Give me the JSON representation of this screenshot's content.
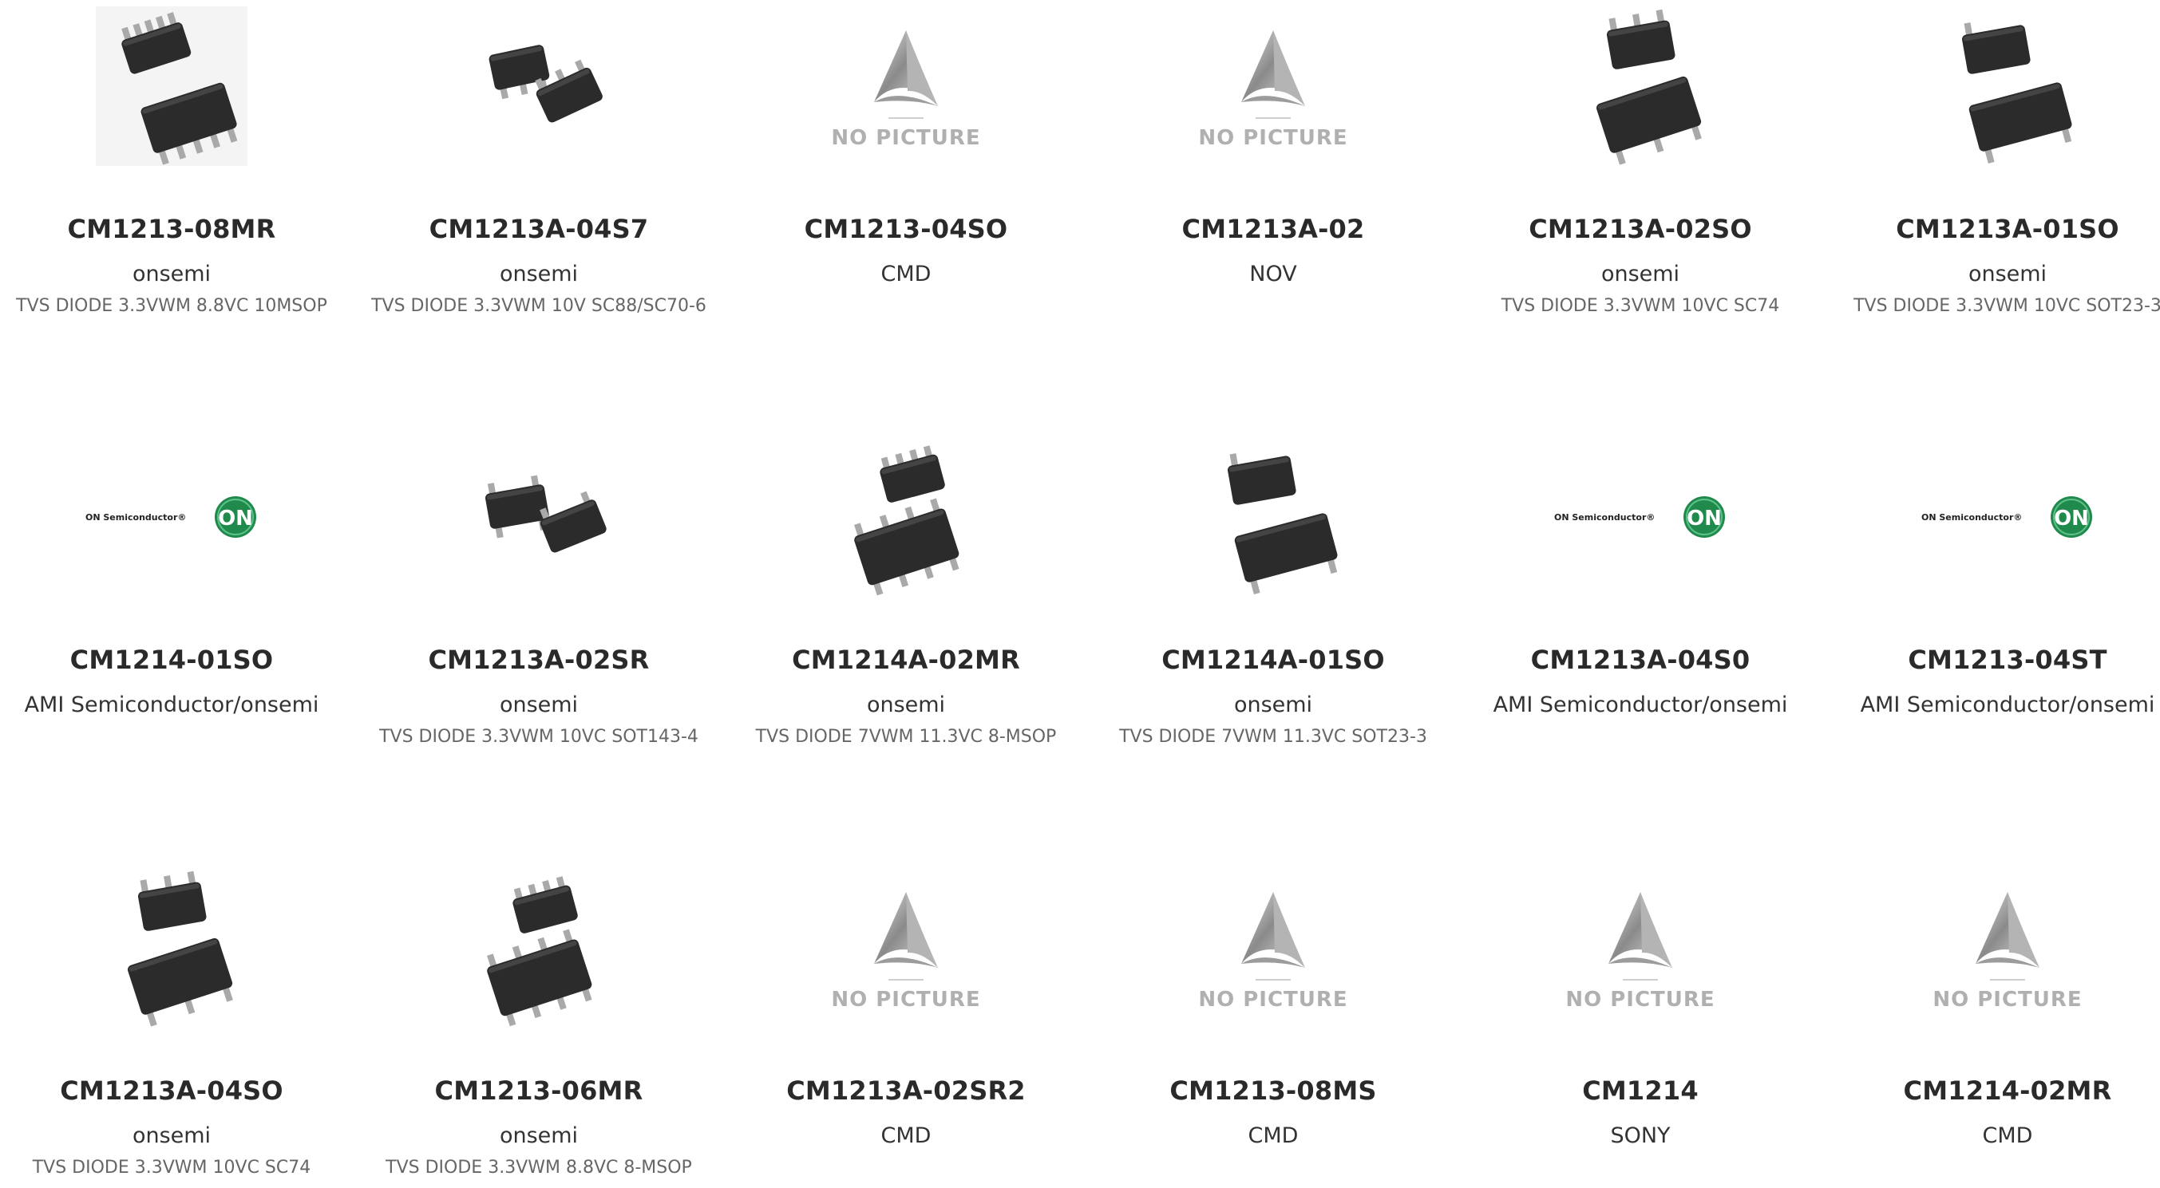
{
  "products": [
    {
      "part": "CM1213-08MR",
      "mfr": "onsemi",
      "desc": "TVS DIODE 3.3VWM 8.8VC 10MSOP",
      "image": "msop-package"
    },
    {
      "part": "CM1213A-04S7",
      "mfr": "onsemi",
      "desc": "TVS DIODE 3.3VWM 10V SC88/SC70-6",
      "image": "sc70-package"
    },
    {
      "part": "CM1213-04SO",
      "mfr": "CMD",
      "desc": "",
      "image": "no-picture",
      "placeholder_text": "NO PICTURE"
    },
    {
      "part": "CM1213A-02",
      "mfr": "NOV",
      "desc": "",
      "image": "no-picture",
      "placeholder_text": "NO PICTURE"
    },
    {
      "part": "CM1213A-02SO",
      "mfr": "onsemi",
      "desc": "TVS DIODE 3.3VWM 10VC SC74",
      "image": "sc74-package"
    },
    {
      "part": "CM1213A-01SO",
      "mfr": "onsemi",
      "desc": "TVS DIODE 3.3VWM 10VC SOT23-3",
      "image": "sot23-package"
    },
    {
      "part": "CM1214-01SO",
      "mfr": "AMI Semiconductor/onsemi",
      "desc": "",
      "image": "on-semi-logo",
      "logo_text": "ON Semiconductor®",
      "logo_badge": "ON"
    },
    {
      "part": "CM1213A-02SR",
      "mfr": "onsemi",
      "desc": "TVS DIODE 3.3VWM 10VC SOT143-4",
      "image": "sot143-package"
    },
    {
      "part": "CM1214A-02MR",
      "mfr": "onsemi",
      "desc": "TVS DIODE 7VWM 11.3VC 8-MSOP",
      "image": "msop8-package"
    },
    {
      "part": "CM1214A-01SO",
      "mfr": "onsemi",
      "desc": "TVS DIODE 7VWM 11.3VC SOT23-3",
      "image": "sot23-package"
    },
    {
      "part": "CM1213A-04S0",
      "mfr": "AMI Semiconductor/onsemi",
      "desc": "",
      "image": "on-semi-logo",
      "logo_text": "ON Semiconductor®",
      "logo_badge": "ON"
    },
    {
      "part": "CM1213-04ST",
      "mfr": "AMI Semiconductor/onsemi",
      "desc": "",
      "image": "on-semi-logo",
      "logo_text": "ON Semiconductor®",
      "logo_badge": "ON"
    },
    {
      "part": "CM1213A-04SO",
      "mfr": "onsemi",
      "desc": "TVS DIODE 3.3VWM 10VC SC74",
      "image": "sc74-package"
    },
    {
      "part": "CM1213-06MR",
      "mfr": "onsemi",
      "desc": "TVS DIODE 3.3VWM 8.8VC 8-MSOP",
      "image": "msop8-package"
    },
    {
      "part": "CM1213A-02SR2",
      "mfr": "CMD",
      "desc": "",
      "image": "no-picture",
      "placeholder_text": "NO PICTURE"
    },
    {
      "part": "CM1213-08MS",
      "mfr": "CMD",
      "desc": "",
      "image": "no-picture",
      "placeholder_text": "NO PICTURE"
    },
    {
      "part": "CM1214",
      "mfr": "SONY",
      "desc": "",
      "image": "no-picture",
      "placeholder_text": "NO PICTURE"
    },
    {
      "part": "CM1214-02MR",
      "mfr": "CMD",
      "desc": "",
      "image": "no-picture",
      "placeholder_text": "NO PICTURE"
    }
  ],
  "colors": {
    "chip_body": "#2b2b2b",
    "chip_lead": "#a9a9a9",
    "on_badge": "#1f8a4c",
    "placeholder_text": "#b0b0b0"
  }
}
